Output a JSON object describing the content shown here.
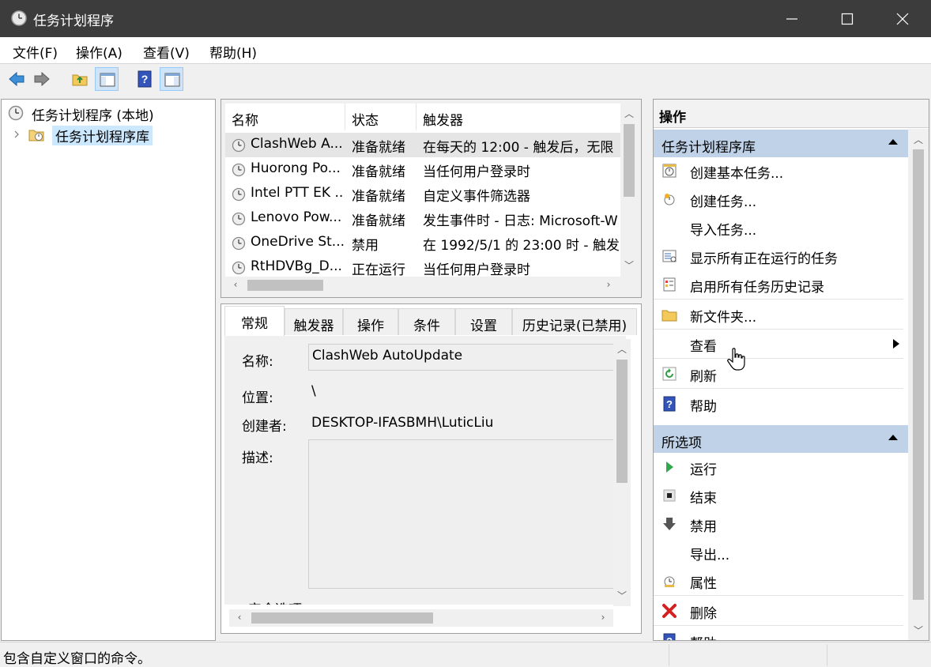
{
  "window": {
    "title": "任务计划程序",
    "minimize_icon": "minimize-icon",
    "maximize_icon": "maximize-icon",
    "close_icon": "close-icon"
  },
  "menu": {
    "items": [
      "文件(F)",
      "操作(A)",
      "查看(V)",
      "帮助(H)"
    ]
  },
  "toolbar": {
    "buttons": [
      "back-arrow-icon",
      "forward-arrow-icon",
      "up-folder-icon",
      "show-hide-console-tree-icon",
      "help-icon",
      "show-hide-action-pane-icon"
    ]
  },
  "tree": {
    "root_label": "任务计划程序 (本地)",
    "child_label": "任务计划程序库"
  },
  "task_list": {
    "columns": [
      "名称",
      "状态",
      "触发器"
    ],
    "rows": [
      {
        "name": "ClashWeb A...",
        "status": "准备就绪",
        "trigger": "在每天的 12:00 - 触发后，无限"
      },
      {
        "name": "Huorong Po...",
        "status": "准备就绪",
        "trigger": "当任何用户登录时"
      },
      {
        "name": "Intel PTT EK ...",
        "status": "准备就绪",
        "trigger": "自定义事件筛选器"
      },
      {
        "name": "Lenovo Pow...",
        "status": "准备就绪",
        "trigger": "发生事件时 - 日志: Microsoft-W"
      },
      {
        "name": "OneDrive St...",
        "status": "禁用",
        "trigger": "在 1992/5/1 的 23:00 时 - 触发"
      },
      {
        "name": "RtHDVBg_D...",
        "status": "正在运行",
        "trigger": "当任何用户登录时"
      }
    ]
  },
  "detail": {
    "tabs": [
      "常规",
      "触发器",
      "操作",
      "条件",
      "设置",
      "历史记录(已禁用)"
    ],
    "name_label": "名称:",
    "name_value": "ClashWeb AutoUpdate",
    "location_label": "位置:",
    "location_value": "\\",
    "author_label": "创建者:",
    "author_value": "DESKTOP-IFASBMH\\LuticLiu",
    "description_label": "描述:",
    "security_label": "安全选项"
  },
  "actions": {
    "title": "操作",
    "section1": {
      "title": "任务计划程序库",
      "items": [
        {
          "label": "创建基本任务...",
          "icon": "create-basic-task-icon"
        },
        {
          "label": "创建任务...",
          "icon": "create-task-icon"
        },
        {
          "label": "导入任务...",
          "icon": ""
        },
        {
          "label": "显示所有正在运行的任务",
          "icon": "running-tasks-icon"
        },
        {
          "label": "启用所有任务历史记录",
          "icon": "history-icon"
        },
        {
          "label": "新文件夹...",
          "icon": "new-folder-icon"
        },
        {
          "label": "查看",
          "icon": ""
        },
        {
          "label": "刷新",
          "icon": "refresh-icon"
        },
        {
          "label": "帮助",
          "icon": "help-icon"
        }
      ]
    },
    "section2": {
      "title": "所选项",
      "items": [
        {
          "label": "运行",
          "icon": "run-icon"
        },
        {
          "label": "结束",
          "icon": "stop-icon"
        },
        {
          "label": "禁用",
          "icon": "disable-icon"
        },
        {
          "label": "导出...",
          "icon": ""
        },
        {
          "label": "属性",
          "icon": "properties-icon"
        },
        {
          "label": "删除",
          "icon": "delete-icon"
        },
        {
          "label": "帮助",
          "icon": "help-icon"
        }
      ]
    }
  },
  "status": {
    "text": "包含自定义窗口的命令。"
  },
  "colors": {
    "titlebar": "#3c3c3c",
    "section_header": "#bfd2e8",
    "selection": "#cce8ff"
  }
}
